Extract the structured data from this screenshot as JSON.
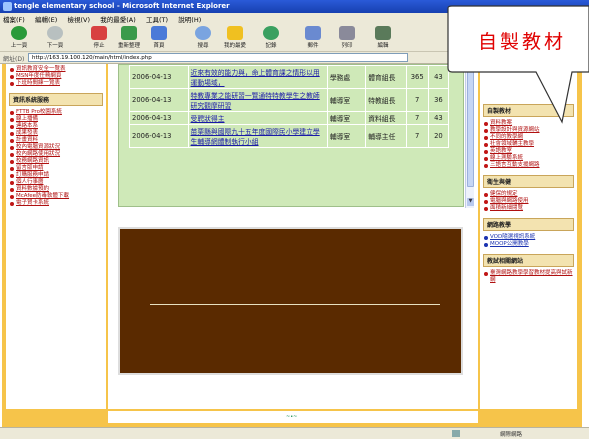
{
  "window": {
    "title": "tengle elementary school - Microsoft Internet Explorer",
    "menu": [
      "檔案(F)",
      "編輯(E)",
      "檢視(V)",
      "我的最愛(A)",
      "工具(T)",
      "說明(H)"
    ],
    "toolbar": [
      {
        "icon": "back-icon",
        "label": "上一頁",
        "color": "#2a9a3a"
      },
      {
        "icon": "forward-icon",
        "label": "下一頁",
        "color": "#9aa"
      },
      {
        "icon": "stop-icon",
        "label": "停止",
        "color": "#d84040"
      },
      {
        "icon": "refresh-icon",
        "label": "重新整理",
        "color": "#3a9a4a"
      },
      {
        "icon": "home-icon",
        "label": "首頁",
        "color": "#4a7ad8"
      },
      {
        "icon": "search-icon",
        "label": "搜尋",
        "color": "#7aa4e0"
      },
      {
        "icon": "favorites-icon",
        "label": "我的最愛",
        "color": "#f0c020"
      },
      {
        "icon": "history-icon",
        "label": "記錄",
        "color": "#3aa060"
      },
      {
        "icon": "mail-icon",
        "label": "郵件",
        "color": "#6a8ad0"
      },
      {
        "icon": "print-icon",
        "label": "列印",
        "color": "#8a8a9a"
      },
      {
        "icon": "edit-icon",
        "label": "編輯",
        "color": "#5a7a5a"
      }
    ],
    "address_label": "網址(D)",
    "address_url": "http://163.19.100.120/main/html/index.php",
    "status_zone": "網際網路"
  },
  "left_sidebar": {
    "top_links": [
      "資訊教育安全一覽表",
      "MSN年度任務網頁",
      "下班時間練一覽表"
    ],
    "section_title": "資訊系統服務",
    "links": [
      "FTTB Pro校園系統",
      "線上播備",
      "連絡本系",
      "成果發表",
      "計畫資料",
      "校內電腦資源狀況",
      "校內網路使用狀況",
      "校務網路資訊",
      "留言版申請",
      "訂購服務申請",
      "個人行事曆",
      "資料數據預約",
      "McAfee防毒軟體下載",
      "電子賀卡系統"
    ]
  },
  "news": {
    "rows": [
      {
        "date": "2006-04-13",
        "title": "近來有效的能力與，命上體育課之情形以用運動場域，",
        "unit": "學務處",
        "person": "體育組長",
        "views": "365",
        "count": "43"
      },
      {
        "date": "2006-04-13",
        "title": "特教專業之能研習一覽通特特教學生之教師研究觀摩研習",
        "unit": "輔導室",
        "person": "特教組長",
        "views": "7",
        "count": "36"
      },
      {
        "date": "2006-04-13",
        "title": "受聘狀得主",
        "unit": "輔導室",
        "person": "資料組長",
        "views": "7",
        "count": "43"
      },
      {
        "date": "2006-04-13",
        "title": "苗栗縣與國際九十五年度國際民小學建立學生輔導網體制執行小組",
        "unit": "輔導室",
        "person": "輔導主任",
        "views": "7",
        "count": "20"
      }
    ]
  },
  "right_sidebar": {
    "sections": [
      {
        "title": "自製教材",
        "links": [
          "資料教案",
          "教學設計與資源網站",
          "不同的教學網",
          "社會領域輔主教學",
          "英語教室",
          "線上測驗系統",
          "三語言互動支援網路"
        ]
      },
      {
        "title": "衛生與健",
        "links": [
          "健保的規定",
          "電腦與網路使用",
          "面積新細閱覽"
        ]
      },
      {
        "title": "網路教學",
        "links": [
          "VOD隨選視訊系統",
          "MOOP公開教學"
        ]
      },
      {
        "title": "教試相關網站",
        "links": [
          "臺灣網路教學學習教材提高與試新網"
        ]
      }
    ]
  },
  "callout": {
    "text": "自製教材",
    "color": "#e00000"
  }
}
